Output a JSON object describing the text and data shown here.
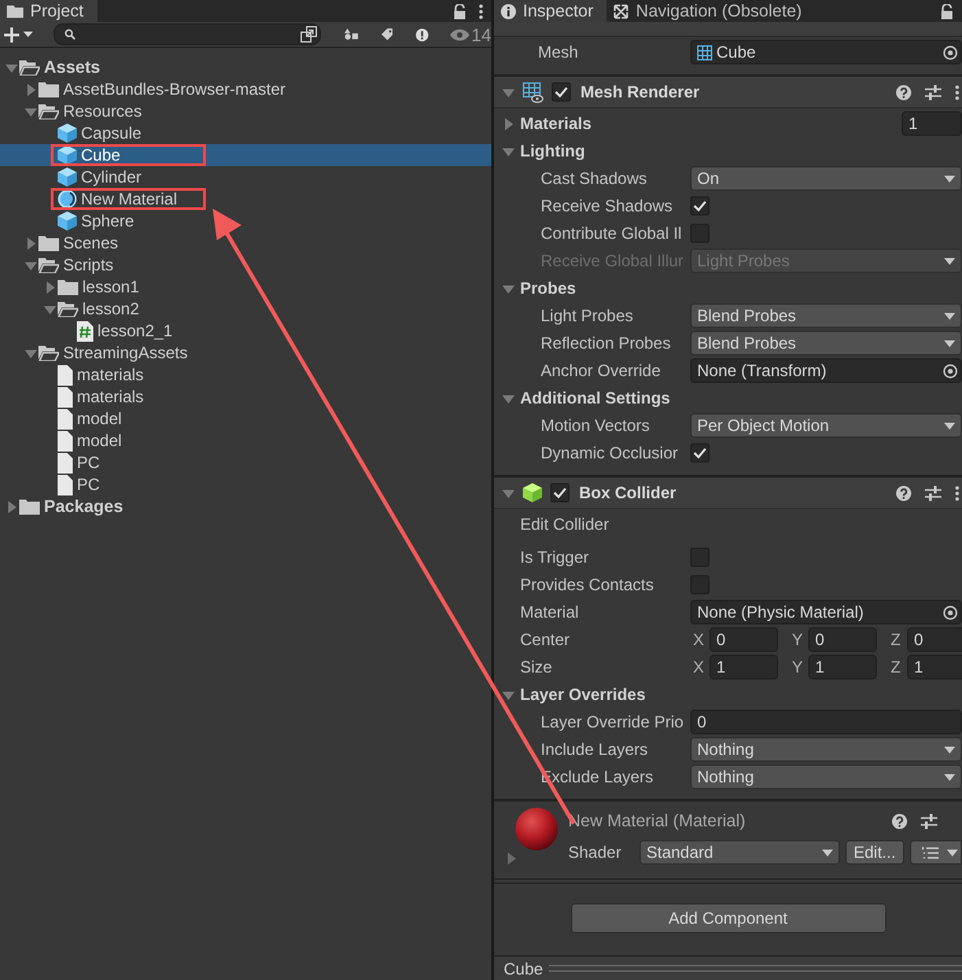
{
  "project_panel": {
    "tab": {
      "title": "Project",
      "selected": true
    },
    "toolbar": {
      "hidden_count": "14"
    },
    "tree": [
      {
        "name": "Assets",
        "kind": "folder",
        "expanded": true,
        "selected": false,
        "highlighted": false,
        "children": [
          {
            "name": "AssetBundles-Browser-master",
            "kind": "folder",
            "expanded": false,
            "selected": false,
            "highlighted": false
          },
          {
            "name": "Resources",
            "kind": "folder",
            "expanded": true,
            "selected": false,
            "highlighted": false,
            "children": [
              {
                "name": "Capsule",
                "kind": "prefab",
                "selected": false,
                "highlighted": false
              },
              {
                "name": "Cube",
                "kind": "prefab",
                "selected": true,
                "highlighted": true
              },
              {
                "name": "Cylinder",
                "kind": "prefab",
                "selected": false,
                "highlighted": false
              },
              {
                "name": "New Material",
                "kind": "material",
                "selected": false,
                "highlighted": true
              },
              {
                "name": "Sphere",
                "kind": "prefab",
                "selected": false,
                "highlighted": false
              }
            ]
          },
          {
            "name": "Scenes",
            "kind": "folder",
            "expanded": false,
            "selected": false,
            "highlighted": false
          },
          {
            "name": "Scripts",
            "kind": "folder",
            "expanded": true,
            "selected": false,
            "highlighted": false,
            "children": [
              {
                "name": "lesson1",
                "kind": "folder",
                "expanded": false,
                "selected": false,
                "highlighted": false
              },
              {
                "name": "lesson2",
                "kind": "folder",
                "expanded": true,
                "selected": false,
                "highlighted": false,
                "children": [
                  {
                    "name": "lesson2_1",
                    "kind": "script",
                    "selected": false,
                    "highlighted": false
                  }
                ]
              }
            ]
          },
          {
            "name": "StreamingAssets",
            "kind": "folder",
            "expanded": true,
            "selected": false,
            "highlighted": false,
            "children": [
              {
                "name": "materials",
                "kind": "file",
                "selected": false,
                "highlighted": false
              },
              {
                "name": "materials",
                "kind": "file",
                "selected": false,
                "highlighted": false
              },
              {
                "name": "model",
                "kind": "file",
                "selected": false,
                "highlighted": false
              },
              {
                "name": "model",
                "kind": "file",
                "selected": false,
                "highlighted": false
              },
              {
                "name": "PC",
                "kind": "file",
                "selected": false,
                "highlighted": false
              },
              {
                "name": "PC",
                "kind": "file",
                "selected": false,
                "highlighted": false
              }
            ]
          }
        ]
      },
      {
        "name": "Packages",
        "kind": "folder",
        "expanded": false,
        "selected": false,
        "highlighted": false
      }
    ]
  },
  "inspector_panel": {
    "tabs": [
      {
        "title": "Inspector",
        "kind": "inspector",
        "selected": true
      },
      {
        "title": "Navigation (Obsolete)",
        "kind": "navigation",
        "selected": false
      }
    ],
    "components": [
      {
        "kind": "mesh_filter",
        "properties": [
          {
            "kind": "asset",
            "label": "Mesh",
            "value": "Cube"
          }
        ]
      },
      {
        "kind": "mesh_renderer",
        "title": "Mesh Renderer",
        "enabled": true,
        "expanded": true,
        "properties": [
          {
            "kind": "foldout",
            "label": "Materials",
            "expanded": false,
            "count": "1"
          },
          {
            "kind": "foldout",
            "label": "Lighting",
            "expanded": true,
            "children": [
              {
                "kind": "dropdown",
                "label": "Cast Shadows",
                "value": "On",
                "disabled": false
              },
              {
                "kind": "checkbox",
                "label": "Receive Shadows",
                "checked": true
              },
              {
                "kind": "checkbox",
                "label": "Contribute Global Il",
                "checked": false
              },
              {
                "kind": "dropdown",
                "label": "Receive Global Illur",
                "value": "Light Probes",
                "disabled": true
              }
            ]
          },
          {
            "kind": "foldout",
            "label": "Probes",
            "expanded": true,
            "children": [
              {
                "kind": "dropdown",
                "label": "Light Probes",
                "value": "Blend Probes",
                "disabled": false
              },
              {
                "kind": "dropdown",
                "label": "Reflection Probes",
                "value": "Blend Probes",
                "disabled": false
              },
              {
                "kind": "object",
                "label": "Anchor Override",
                "value": "None (Transform)"
              }
            ]
          },
          {
            "kind": "foldout",
            "label": "Additional Settings",
            "expanded": true,
            "children": [
              {
                "kind": "dropdown",
                "label": "Motion Vectors",
                "value": "Per Object Motion",
                "disabled": false
              },
              {
                "kind": "checkbox",
                "label": "Dynamic Occlusior",
                "checked": true
              }
            ]
          }
        ]
      },
      {
        "kind": "box_collider",
        "title": "Box Collider",
        "enabled": true,
        "expanded": true,
        "properties": [
          {
            "kind": "label",
            "label": "Edit Collider"
          },
          {
            "kind": "checkbox",
            "label": "Is Trigger",
            "checked": false
          },
          {
            "kind": "checkbox",
            "label": "Provides Contacts",
            "checked": false
          },
          {
            "kind": "object",
            "label": "Material",
            "value": "None (Physic Material)"
          },
          {
            "kind": "vector",
            "label": "Center",
            "axes": [
              {
                "axis": "X",
                "value": "0"
              },
              {
                "axis": "Y",
                "value": "0"
              },
              {
                "axis": "Z",
                "value": "0"
              }
            ]
          },
          {
            "kind": "vector",
            "label": "Size",
            "axes": [
              {
                "axis": "X",
                "value": "1"
              },
              {
                "axis": "Y",
                "value": "1"
              },
              {
                "axis": "Z",
                "value": "1"
              }
            ]
          },
          {
            "kind": "foldout",
            "label": "Layer Overrides",
            "expanded": true,
            "children": [
              {
                "kind": "number",
                "label": "Layer Override Prio",
                "value": "0"
              },
              {
                "kind": "dropdown",
                "label": "Include Layers",
                "value": "Nothing",
                "disabled": false
              },
              {
                "kind": "dropdown",
                "label": "Exclude Layers",
                "value": "Nothing",
                "disabled": false
              }
            ]
          }
        ]
      },
      {
        "kind": "material",
        "title": "New Material (Material)",
        "expanded": false,
        "shader_label": "Shader",
        "shader": "Standard",
        "edit_button": "Edit..."
      }
    ],
    "add_component_button": "Add Component",
    "preview_bar": {
      "title": "Cube"
    }
  }
}
